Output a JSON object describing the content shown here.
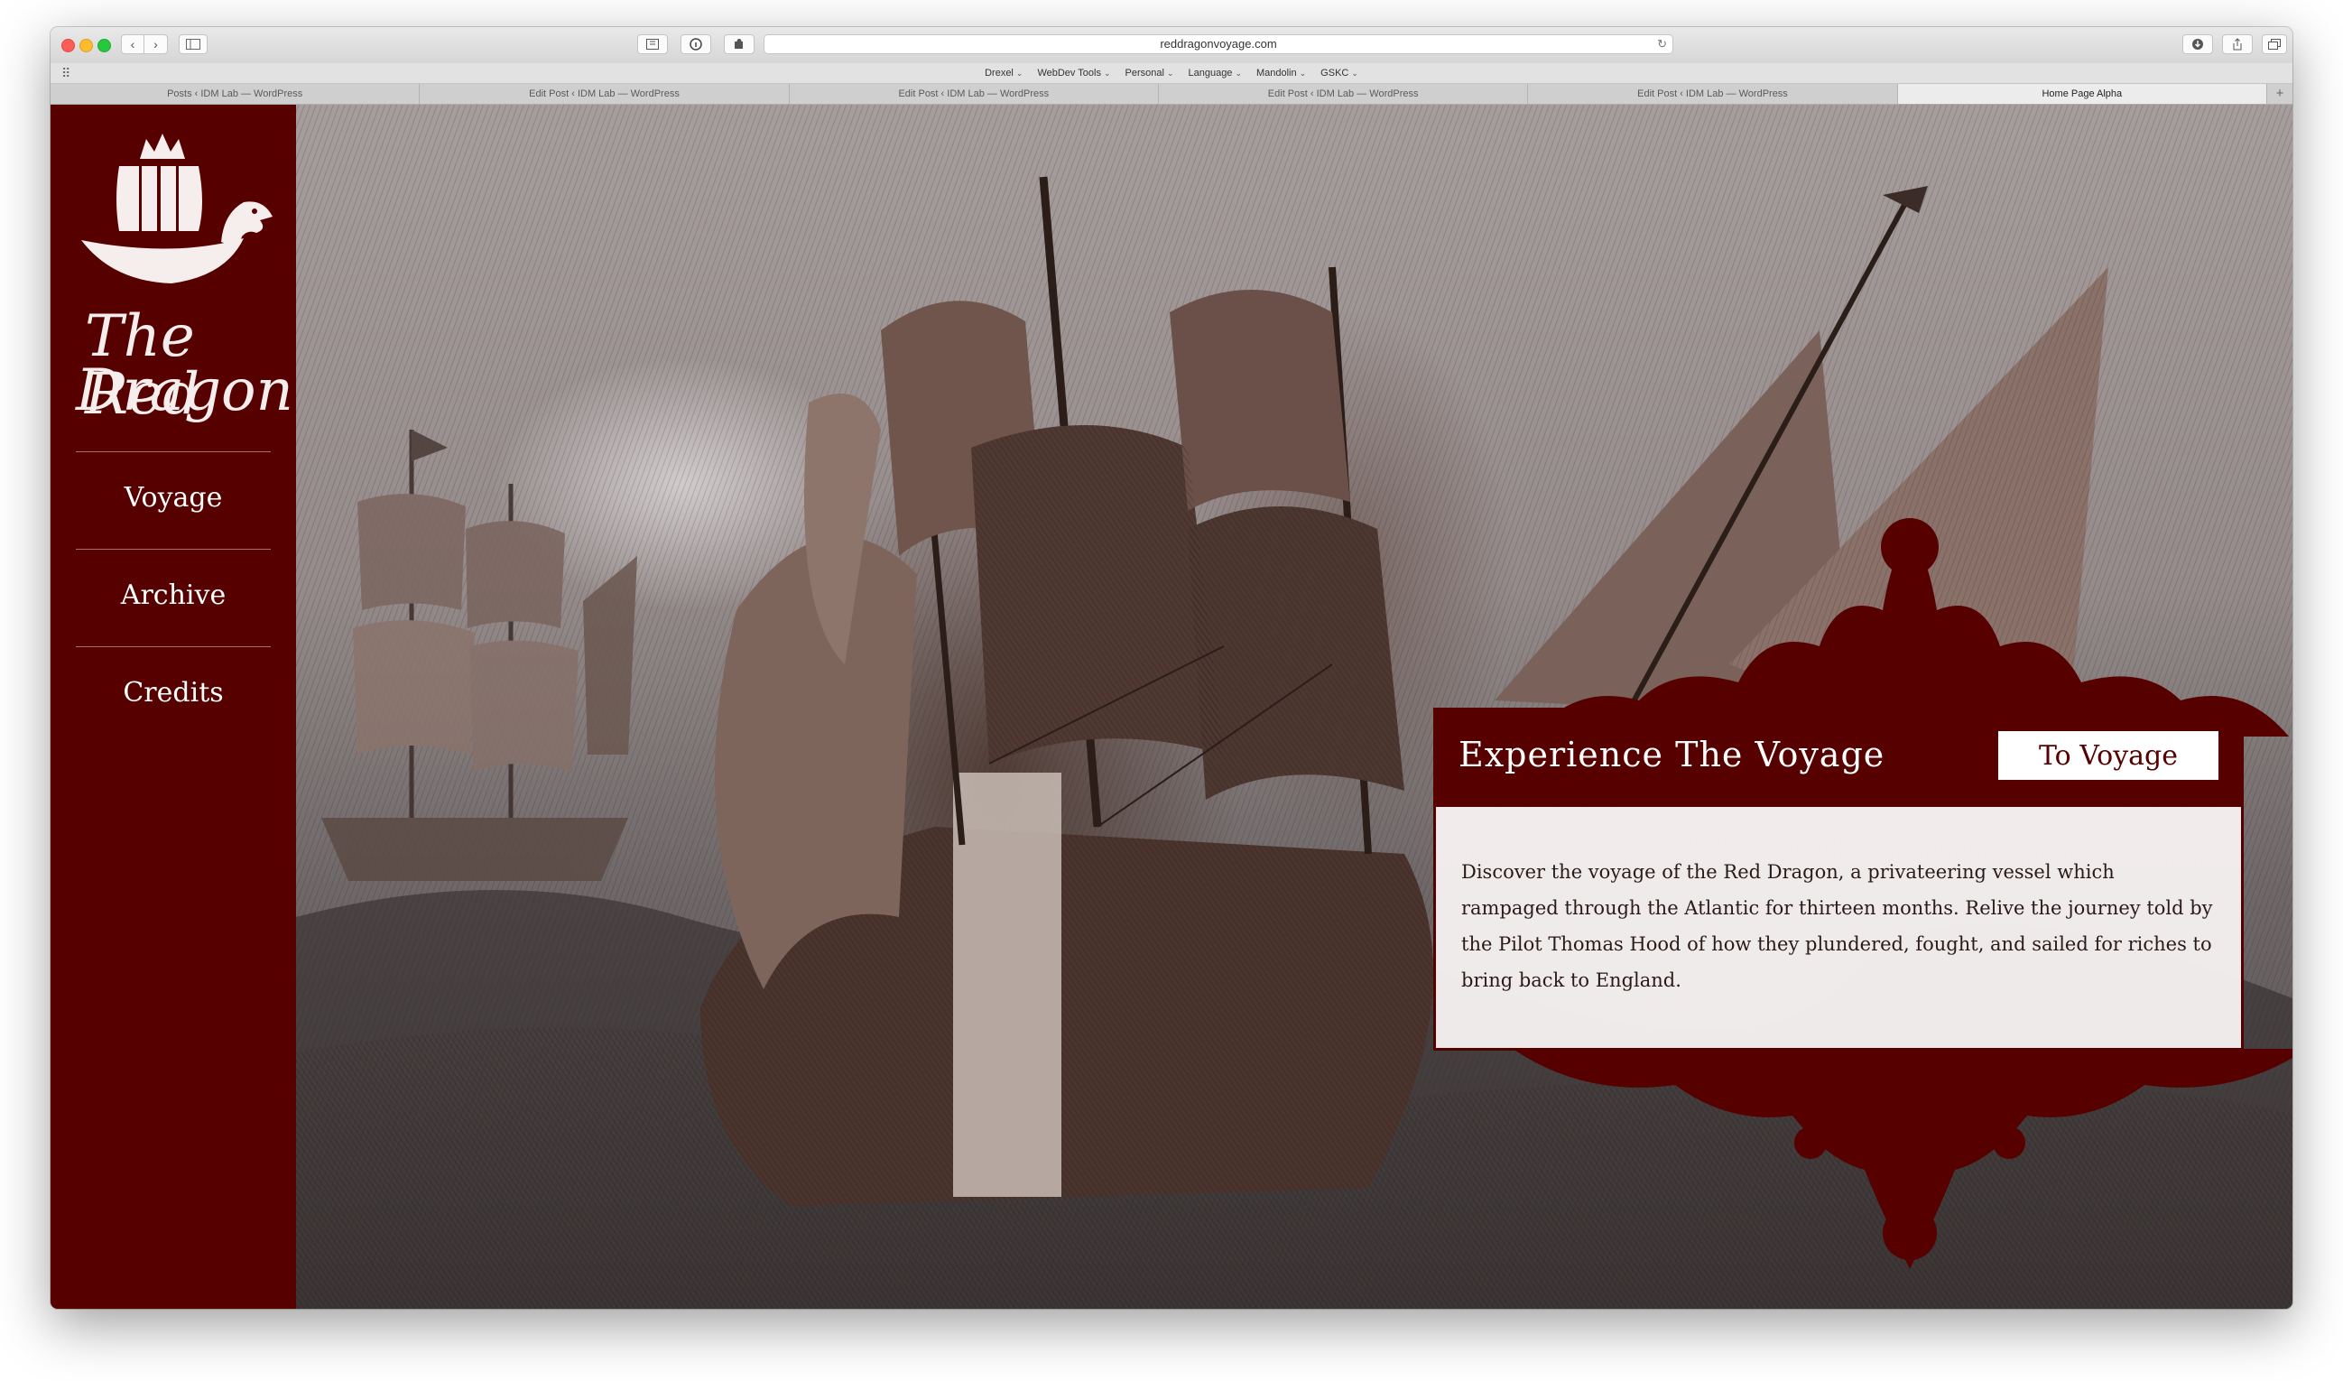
{
  "browser": {
    "url": "reddragonvoyage.com",
    "bookmarks": [
      {
        "label": "Drexel"
      },
      {
        "label": "WebDev Tools"
      },
      {
        "label": "Personal"
      },
      {
        "label": "Language"
      },
      {
        "label": "Mandolin"
      },
      {
        "label": "GSKC"
      }
    ],
    "tabs": [
      {
        "label": "Posts ‹ IDM Lab — WordPress"
      },
      {
        "label": "Edit Post ‹ IDM Lab — WordPress"
      },
      {
        "label": "Edit Post ‹ IDM Lab — WordPress"
      },
      {
        "label": "Edit Post ‹ IDM Lab — WordPress"
      },
      {
        "label": "Edit Post ‹ IDM Lab — WordPress"
      },
      {
        "label": "Home Page Alpha"
      }
    ],
    "icons": {
      "back": "chevron-left-icon",
      "forward": "chevron-right-icon",
      "sidebar": "sidebar-icon",
      "reload": "reload-icon",
      "downloads": "download-icon",
      "share": "share-icon",
      "tabs": "tabs-overview-icon",
      "new_tab": "plus-icon"
    }
  },
  "site": {
    "logo": {
      "line1": "The Red",
      "line2": "Dragon"
    },
    "nav": [
      {
        "label": "Voyage"
      },
      {
        "label": "Archive"
      },
      {
        "label": "Credits"
      }
    ],
    "feature": {
      "title": "Experience The Voyage",
      "button": "To Voyage",
      "body": "Discover the voyage of the Red Dragon, a privateering vessel which rampaged through the Atlantic for thirteen months. Relive the journey told by the Pilot Thomas Hood of how they plundered, fought, and sailed for riches to bring back to England."
    },
    "colors": {
      "brand": "#560000",
      "text_light": "#ffffff",
      "card_bg": "#f5f0f0"
    }
  }
}
